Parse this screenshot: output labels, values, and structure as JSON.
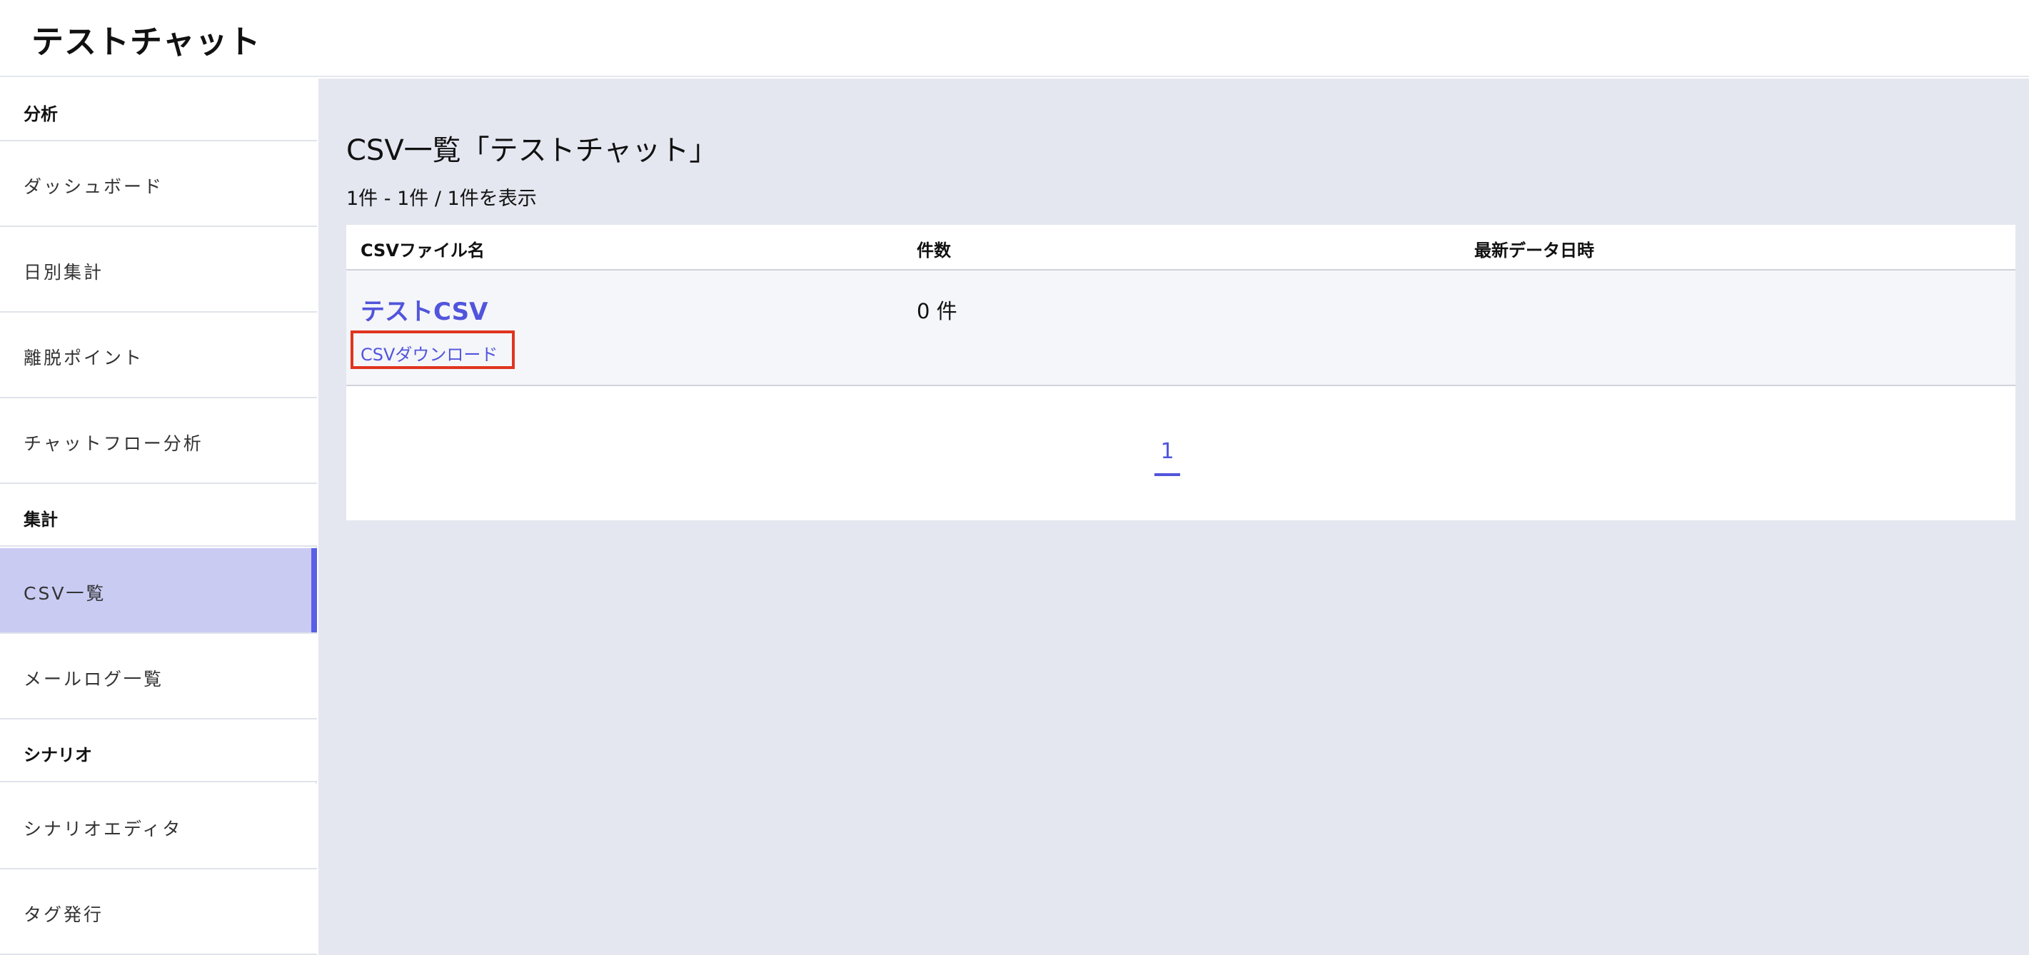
{
  "app": {
    "title": "テストチャット"
  },
  "sidebar": {
    "sections": [
      {
        "label": "分析"
      },
      {
        "label": "集計"
      },
      {
        "label": "シナリオ"
      }
    ],
    "items": [
      {
        "label": "ダッシュボード"
      },
      {
        "label": "日別集計"
      },
      {
        "label": "離脱ポイント"
      },
      {
        "label": "チャットフロー分析"
      },
      {
        "label": "CSV一覧",
        "active": true
      },
      {
        "label": "メールログ一覧"
      },
      {
        "label": "シナリオエディタ"
      },
      {
        "label": "タグ発行"
      }
    ]
  },
  "main": {
    "title": "CSV一覧「テストチャット」",
    "count_text": "1件 - 1件 / 1件を表示",
    "table": {
      "headers": [
        "CSVファイル名",
        "件数",
        "最新データ日時"
      ],
      "rows": [
        {
          "name": "テストCSV",
          "download": "CSVダウンロード",
          "count": "0 件",
          "latest": ""
        }
      ]
    },
    "pagination": {
      "current": "1"
    }
  },
  "colors": {
    "accent": "#5155dc",
    "active_bg": "#c9cbf3",
    "active_bar": "#5a5fe6",
    "content_bg": "#e4e7f0",
    "highlight_box": "#e0341f"
  }
}
